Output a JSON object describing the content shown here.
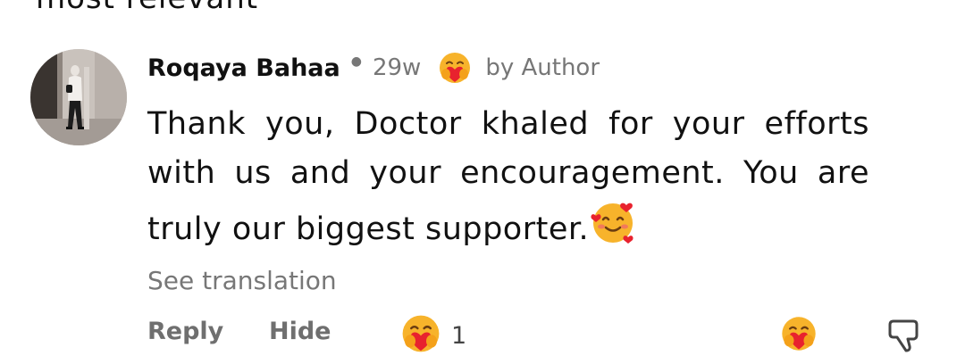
{
  "previous_comment": {
    "tail_text": "most relevant"
  },
  "comment": {
    "author_name": "Roqaya Bahaa",
    "timestamp": "29w",
    "author_badge": "by Author",
    "body": "Thank you, Doctor khaled for your efforts with us and your encouragement. You are truly our biggest supporter.",
    "see_translation": "See translation",
    "reply_label": "Reply",
    "hide_label": "Hide",
    "reaction_count": "1"
  },
  "icons": {
    "avatar": "avatar-photo",
    "badge": "hugging-heart-emoji",
    "inline": "smiling-face-with-hearts-emoji",
    "reaction": "hugging-heart-emoji",
    "react_button": "hugging-heart-emoji",
    "dislike": "thumbs-down-icon"
  },
  "colors": {
    "muted_text": "#777777",
    "action_text": "#6f6f6f",
    "emoji_yellow": "#f7b32b",
    "heart_red": "#e8222e"
  }
}
